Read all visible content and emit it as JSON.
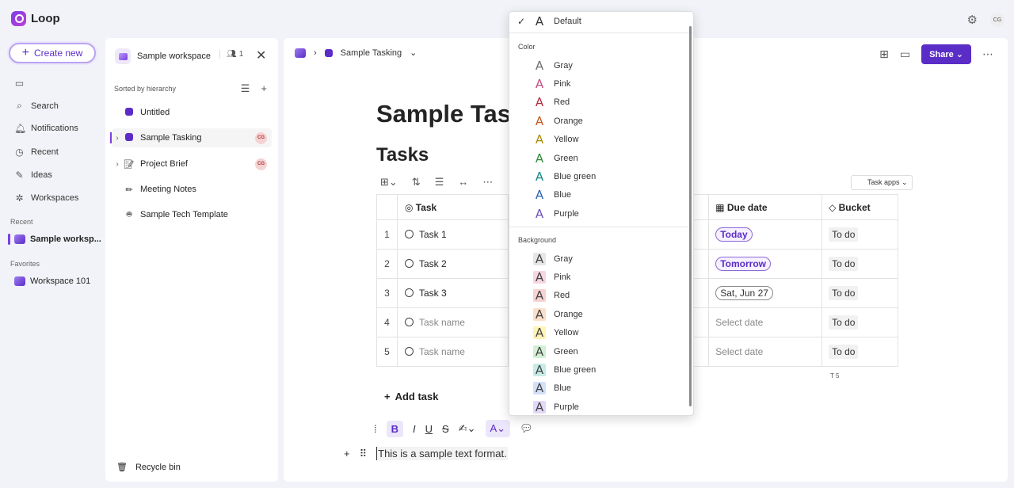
{
  "app": {
    "name": "Loop",
    "avatar_initials": "CG"
  },
  "leftnav": {
    "create_label": "Create new",
    "items": [
      "Search",
      "Notifications",
      "Recent",
      "Ideas",
      "Workspaces"
    ],
    "recent_label": "Recent",
    "recent_item": "Sample worksp...",
    "favorites_label": "Favorites",
    "favorite_item": "Workspace 101"
  },
  "workspace": {
    "name": "Sample workspace",
    "member_count": "1",
    "sorted_label": "Sorted by hierarchy",
    "pages": [
      "Untitled",
      "Sample Tasking",
      "Project Brief",
      "Meeting Notes",
      "Sample Tech Template"
    ],
    "badge": "CG",
    "recycle_label": "Recycle bin"
  },
  "main": {
    "breadcrumb": "Sample Tasking",
    "share_label": "Share",
    "page_title": "Sample Taski",
    "section_title": "Tasks",
    "task_apps_label": "Task apps",
    "columns": {
      "task": "Task",
      "due": "Due date",
      "bucket": "Bucket"
    },
    "rows": [
      {
        "num": "1",
        "task": "Task 1",
        "due": "Today",
        "bucket": "To do"
      },
      {
        "num": "2",
        "task": "Task 2",
        "due": "Tomorrow",
        "bucket": "To do"
      },
      {
        "num": "3",
        "task": "Task 3",
        "due": "Sat, Jun 27",
        "bucket": "To do"
      },
      {
        "num": "4",
        "task": "Task name",
        "due": "Select date",
        "bucket": "To do"
      },
      {
        "num": "5",
        "task": "Task name",
        "due": "Select date",
        "bucket": "To do"
      }
    ],
    "table_footer": "5",
    "add_task_label": "Add task",
    "sample_text": "This is a sample text format."
  },
  "dropdown": {
    "default_label": "Default",
    "color_header": "Color",
    "background_header": "Background",
    "colors": [
      {
        "label": "Gray",
        "hex": "#6d6d6d"
      },
      {
        "label": "Pink",
        "hex": "#c34d7a"
      },
      {
        "label": "Red",
        "hex": "#b22a3a"
      },
      {
        "label": "Orange",
        "hex": "#c0581c"
      },
      {
        "label": "Yellow",
        "hex": "#a88a00"
      },
      {
        "label": "Green",
        "hex": "#2e8b3a"
      },
      {
        "label": "Blue green",
        "hex": "#108a85"
      },
      {
        "label": "Blue",
        "hex": "#2a62b8"
      },
      {
        "label": "Purple",
        "hex": "#6f4fb8"
      }
    ],
    "backgrounds": [
      {
        "label": "Gray",
        "hex": "#e6e6e6"
      },
      {
        "label": "Pink",
        "hex": "#f7d5e1"
      },
      {
        "label": "Red",
        "hex": "#f7d2d2"
      },
      {
        "label": "Orange",
        "hex": "#fbdfc8"
      },
      {
        "label": "Yellow",
        "hex": "#fff3b5"
      },
      {
        "label": "Green",
        "hex": "#d3efd4"
      },
      {
        "label": "Blue green",
        "hex": "#c6ece8"
      },
      {
        "label": "Blue",
        "hex": "#d3e1f7"
      },
      {
        "label": "Purple",
        "hex": "#e2d9f6"
      }
    ]
  }
}
